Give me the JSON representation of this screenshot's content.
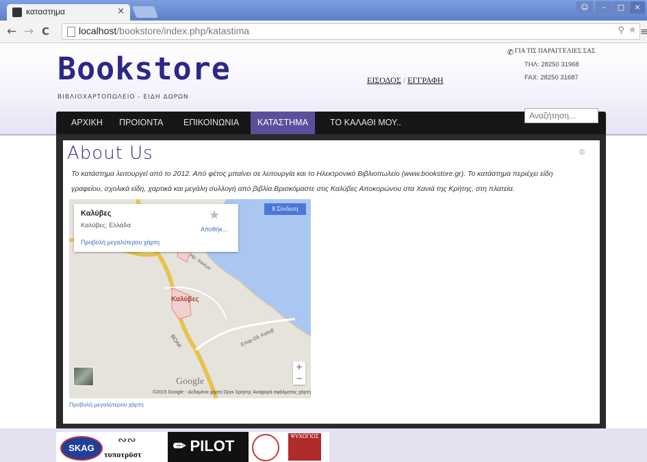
{
  "browser": {
    "tab_title": "καταστημα",
    "tab_close": "×",
    "url_host": "localhost",
    "url_path": "/bookstore/index.php/katastima"
  },
  "header": {
    "logo": "Bookstore",
    "tagline": "ΒΙΒΛΙΟΧΑΡΤΟΠΩΛΕΙΟ - ΕΙΔΗ ΔΩΡΩΝ",
    "login": "ΕΙΣΟΔΟΣ",
    "separator": "/",
    "register": "ΕΓΓΡΑΦΗ",
    "contact_title": "ΓΙΑ ΤΙΣ ΠΑΡΑΓΓΕΛΙΕΣ ΣΑΣ",
    "phone": "ΤΗΛ: 28250 31968",
    "fax": "FAX: 28250 31687"
  },
  "nav": {
    "items": [
      "ΑΡΧΙΚΗ",
      "ΠΡΟΙΟΝΤΑ",
      "ΕΠΙΚΟΙΝΩΝΙΑ",
      "ΚΑΤΑΣΤΗΜΑ",
      "ΤΟ ΚΑΛΑΘΙ ΜΟΥ.."
    ],
    "active_index": 3,
    "search_placeholder": "Αναζήτηση..."
  },
  "article": {
    "title": "About Us",
    "line1": "Το κατάστημα λειτουργεί από το 2012. Από φέτος μπαίνει σε λειτουργία και το Ηλεκτρονικό Βιβλιοπωλείο (www.bookstore.gr). Το κατάστημα περιέχει είδη",
    "line2": "γραφείου, σχολικά είδη, χαρτικά και μεγάλη συλλογή από βιβλία.Βρισκόμαστε στις Καλύβες  Αποκορώνου στα Χανιά της Κρήτης, στη πλατεία."
  },
  "map": {
    "place_name": "Καλύβες",
    "place_address": "Καλύβες, Ελλάδα",
    "larger_map_link": "Προβολή μεγαλύτερου χάρτη",
    "save_label": "Αποθήκ...",
    "signin_label": "8 Σύνδεση",
    "town_label": "Καλύβες",
    "road_label_1": "ΒΟΑΚ",
    "road_label_2": "Επαρ.Οδ. Καλυβ",
    "road_label_3": "Ηρ. Χανίων",
    "google": "Google",
    "footer": "©2015 Google - Δεδομένα χάρτη   Όροι Χρήσης   Αναφορά σφάλματος χάρτη",
    "zoom_in": "+",
    "zoom_out": "−",
    "below_link": "Προβολή μεγαλύτερου χάρτη"
  },
  "partners": {
    "skag": "SKAG",
    "typotrast": "τυποτρϋστ",
    "pilot": "PILOT",
    "psychogios": "ΨΥΧΟΓΙΟΣ"
  },
  "colors": {
    "brand": "#2c2889",
    "nav_active": "#5a4f9c",
    "link": "#3a6ec0"
  }
}
